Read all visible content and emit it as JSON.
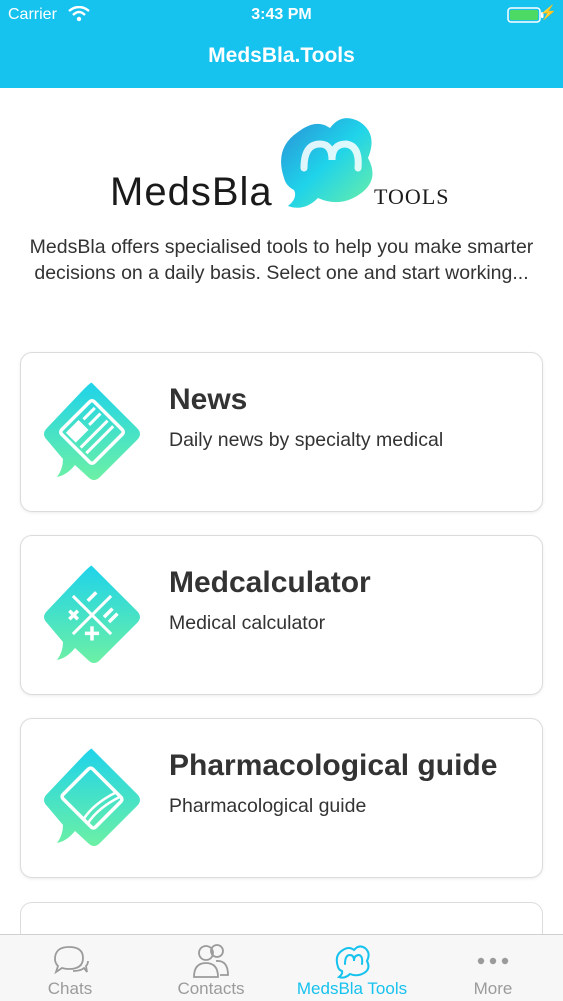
{
  "status_bar": {
    "carrier": "Carrier",
    "time": "3:43 PM"
  },
  "nav": {
    "title": "MedsBla.Tools"
  },
  "logo": {
    "brand": "MedsBla",
    "suffix": "TOOLS"
  },
  "intro": "MedsBla offers specialised tools to help you make smarter decisions on a daily basis. Select one and start working...",
  "tools": [
    {
      "title": "News",
      "subtitle": "Daily news by specialty medical",
      "icon": "newspaper-icon"
    },
    {
      "title": "Medcalculator",
      "subtitle": "Medical calculator",
      "icon": "calculator-icon"
    },
    {
      "title": "Pharmacological guide",
      "subtitle": "Pharmacological guide",
      "icon": "book-icon"
    }
  ],
  "tabs": [
    {
      "label": "Chats",
      "icon": "chat-bubbles-icon"
    },
    {
      "label": "Contacts",
      "icon": "contacts-icon"
    },
    {
      "label": "MedsBla Tools",
      "icon": "medsbla-logo-icon",
      "active": true
    },
    {
      "label": "More",
      "icon": "ellipsis-icon"
    }
  ],
  "colors": {
    "accent": "#16c2ee",
    "gradient_start": "#1fd3ea",
    "gradient_end": "#6cf0a5"
  }
}
